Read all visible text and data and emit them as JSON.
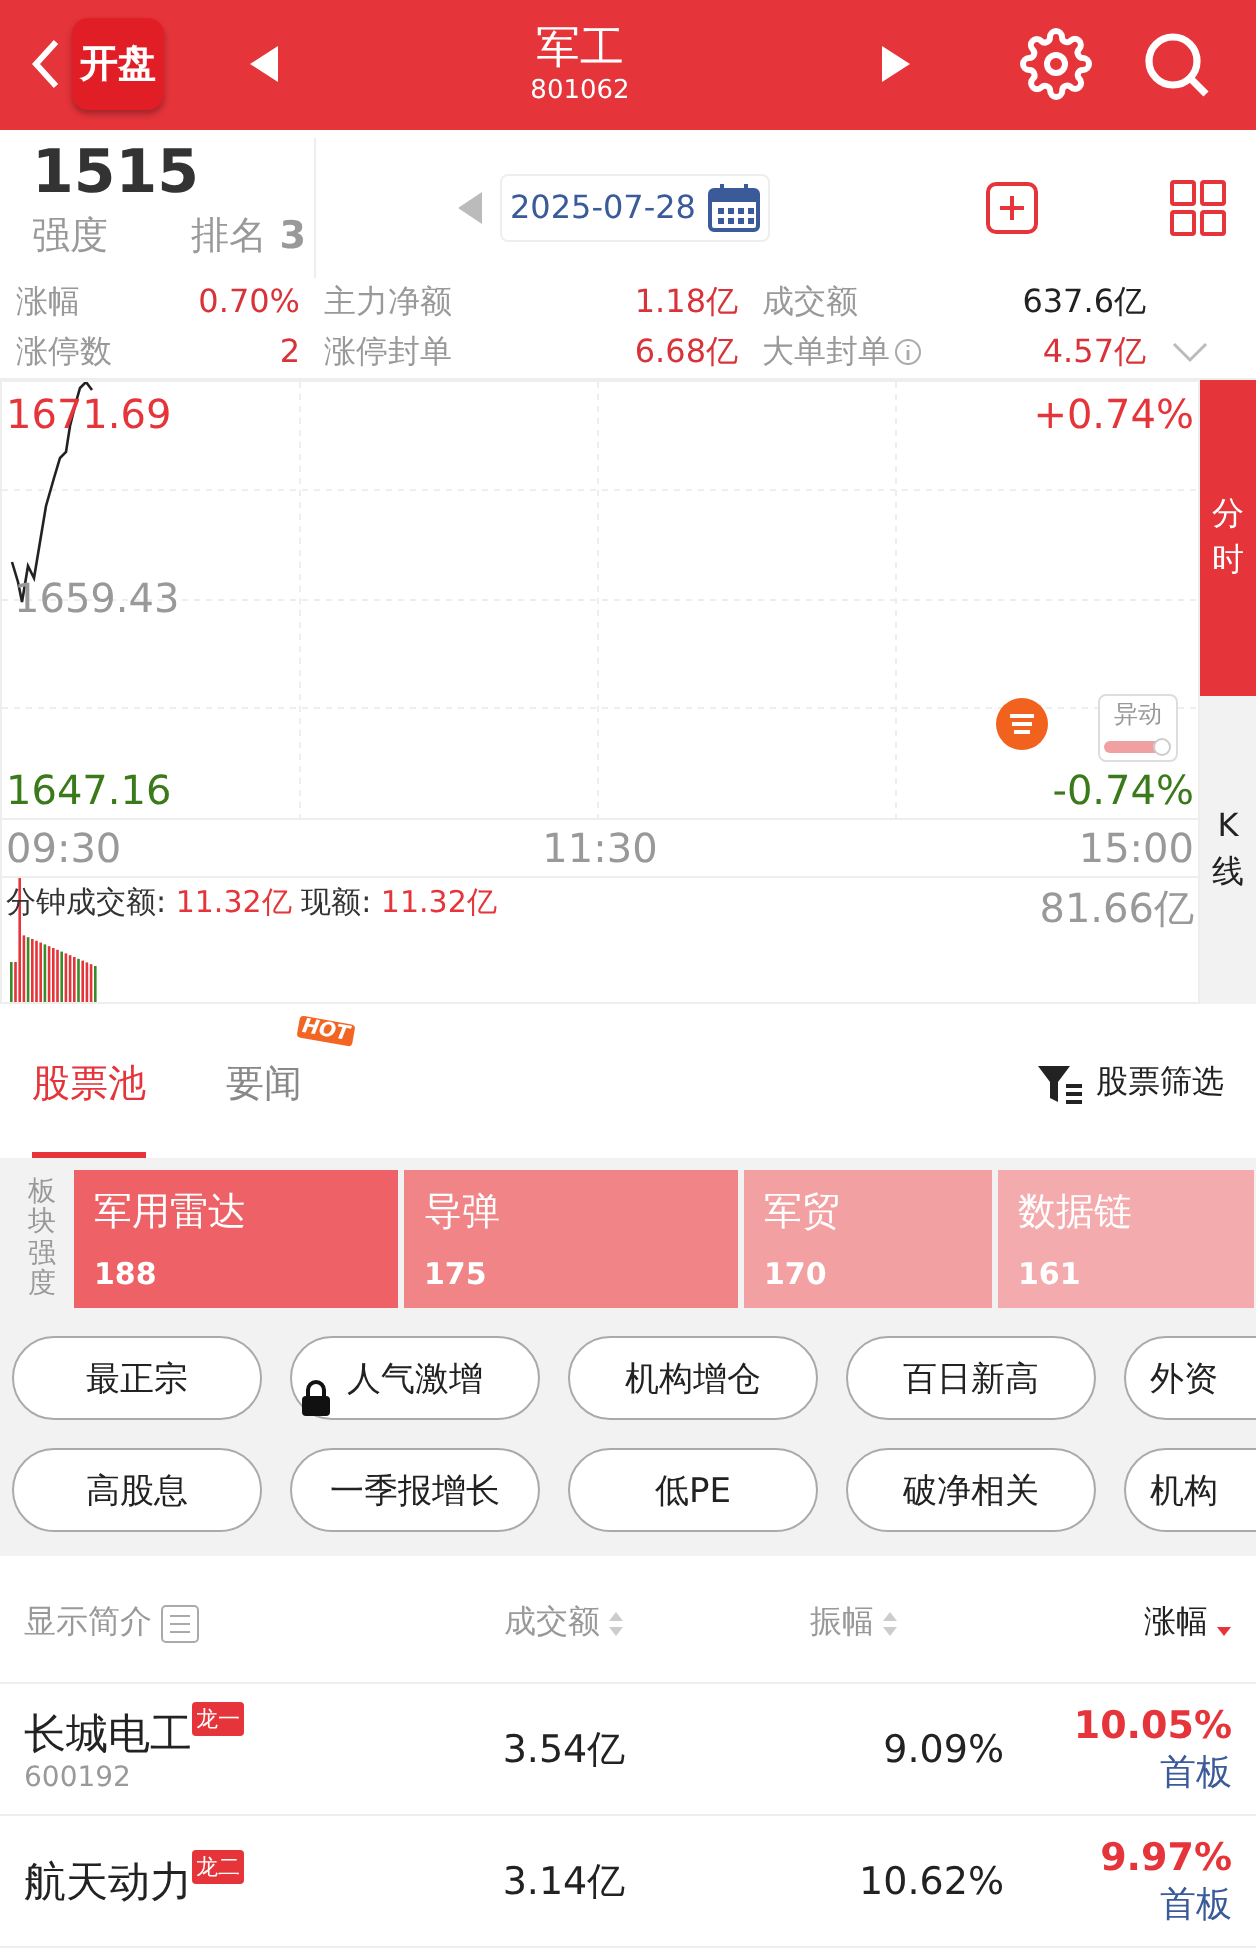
{
  "header": {
    "logo": "开盘",
    "title": "军工",
    "code": "801062"
  },
  "summary": {
    "strength": "1515",
    "strength_label": "强度",
    "rank_label": "排名",
    "rank": "3",
    "date": "2025-07-28",
    "stats": [
      {
        "label": "涨幅",
        "value": "0.70%",
        "color": "#d9333a"
      },
      {
        "label": "主力净额",
        "value": "1.18亿",
        "color": "#d9333a"
      },
      {
        "label": "成交额",
        "value": "637.6亿",
        "color": "#222222"
      },
      {
        "label": "涨停数",
        "value": "2",
        "color": "#d9333a"
      },
      {
        "label": "涨停封单",
        "value": "6.68亿",
        "color": "#d9333a"
      },
      {
        "label": "大单封单",
        "value": "4.57亿",
        "color": "#d9333a",
        "info": true
      }
    ]
  },
  "chart": {
    "high": "1671.69",
    "mid": "1659.43",
    "low": "1647.16",
    "high_pct": "+0.74%",
    "low_pct": "-0.74%",
    "times": [
      "09:30",
      "11:30",
      "15:00"
    ],
    "volume_label": "分钟成交额:",
    "volume_value": "11.32亿",
    "now_label": "现额:",
    "now_value": "11.32亿",
    "volume_max": "81.66亿",
    "alert": "异动",
    "side_tabs": [
      {
        "label": "分时",
        "selected": true
      },
      {
        "label": "K线",
        "selected": false
      }
    ]
  },
  "tabs": [
    {
      "label": "股票池",
      "selected": true
    },
    {
      "label": "要闻",
      "selected": false,
      "hot": "HOT"
    }
  ],
  "filter": "股票筛选",
  "sectors": {
    "label": "板块强度",
    "items": [
      {
        "name": "军用雷达",
        "score": "188",
        "color": "#ee6166"
      },
      {
        "name": "导弹",
        "score": "175",
        "color": "#f08486"
      },
      {
        "name": "军贸",
        "score": "170",
        "color": "#f3a0a2"
      },
      {
        "name": "数据链",
        "score": "161",
        "color": "#f3abad"
      }
    ]
  },
  "chips": [
    [
      {
        "label": "最正宗",
        "locked": false
      },
      {
        "label": "人气激增",
        "locked": true
      },
      {
        "label": "机构增仓",
        "locked": false
      },
      {
        "label": "百日新高",
        "locked": false
      },
      {
        "label": "外资",
        "locked": false
      }
    ],
    [
      {
        "label": "高股息",
        "locked": false
      },
      {
        "label": "一季报增长",
        "locked": false
      },
      {
        "label": "低PE",
        "locked": false
      },
      {
        "label": "破净相关",
        "locked": false
      },
      {
        "label": "机构",
        "locked": false
      }
    ]
  ],
  "table": {
    "columns": [
      {
        "label": "显示简介",
        "kind": "toggle"
      },
      {
        "label": "成交额",
        "kind": "sort",
        "sorted": false
      },
      {
        "label": "振幅",
        "kind": "sort",
        "sorted": false
      },
      {
        "label": "涨幅",
        "kind": "sort",
        "sorted": true
      }
    ],
    "rows": [
      {
        "name": "长城电工",
        "tag": "龙一",
        "code": "600192",
        "amount": "3.54亿",
        "amplitude": "9.09%",
        "change": "10.05%",
        "board": "首板"
      },
      {
        "name": "航天动力",
        "tag": "龙二",
        "amount": "3.14亿",
        "amplitude": "10.62%",
        "change": "9.97%",
        "board": "首板"
      }
    ]
  }
}
